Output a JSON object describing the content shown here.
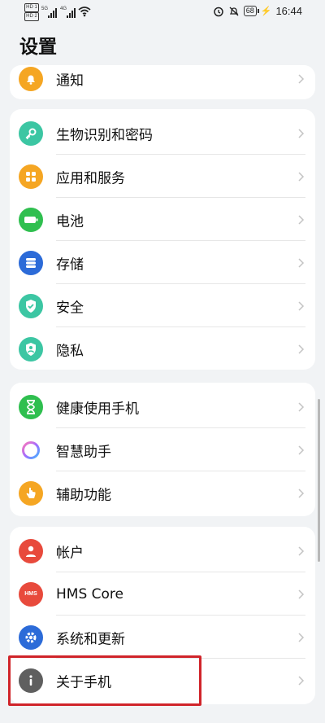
{
  "status_bar": {
    "sim1": "HD 1",
    "sim2": "HD 2",
    "net1": "5G",
    "net2": "4G",
    "battery": "68",
    "time": "16:44"
  },
  "page": {
    "title": "设置"
  },
  "sections": [
    {
      "items": [
        {
          "label": "通知",
          "icon": "bell-icon",
          "color": "#f5a623"
        }
      ]
    },
    {
      "items": [
        {
          "label": "生物识别和密码",
          "icon": "key-icon",
          "color": "#3cc6a3"
        },
        {
          "label": "应用和服务",
          "icon": "apps-grid-icon",
          "color": "#f5a623"
        },
        {
          "label": "电池",
          "icon": "battery-icon",
          "color": "#2fbf4f"
        },
        {
          "label": "存储",
          "icon": "storage-icon",
          "color": "#2c6bd8"
        },
        {
          "label": "安全",
          "icon": "shield-check-icon",
          "color": "#3cc6a3"
        },
        {
          "label": "隐私",
          "icon": "privacy-icon",
          "color": "#3cc6a3"
        }
      ]
    },
    {
      "items": [
        {
          "label": "健康使用手机",
          "icon": "hourglass-icon",
          "color": "#2fbf4f"
        },
        {
          "label": "智慧助手",
          "icon": "assistant-ring-icon",
          "color": "#b36bff"
        },
        {
          "label": "辅助功能",
          "icon": "hand-tap-icon",
          "color": "#f5a623"
        }
      ]
    },
    {
      "items": [
        {
          "label": "帐户",
          "icon": "user-icon",
          "color": "#e84a3c"
        },
        {
          "label": "HMS Core",
          "icon": "hms-icon",
          "color": "#e84a3c",
          "icon_text": "HMS"
        },
        {
          "label": "系统和更新",
          "icon": "gear-icon",
          "color": "#2c6bd8"
        },
        {
          "label": "关于手机",
          "icon": "info-icon",
          "color": "#5f5f5f"
        }
      ]
    }
  ]
}
